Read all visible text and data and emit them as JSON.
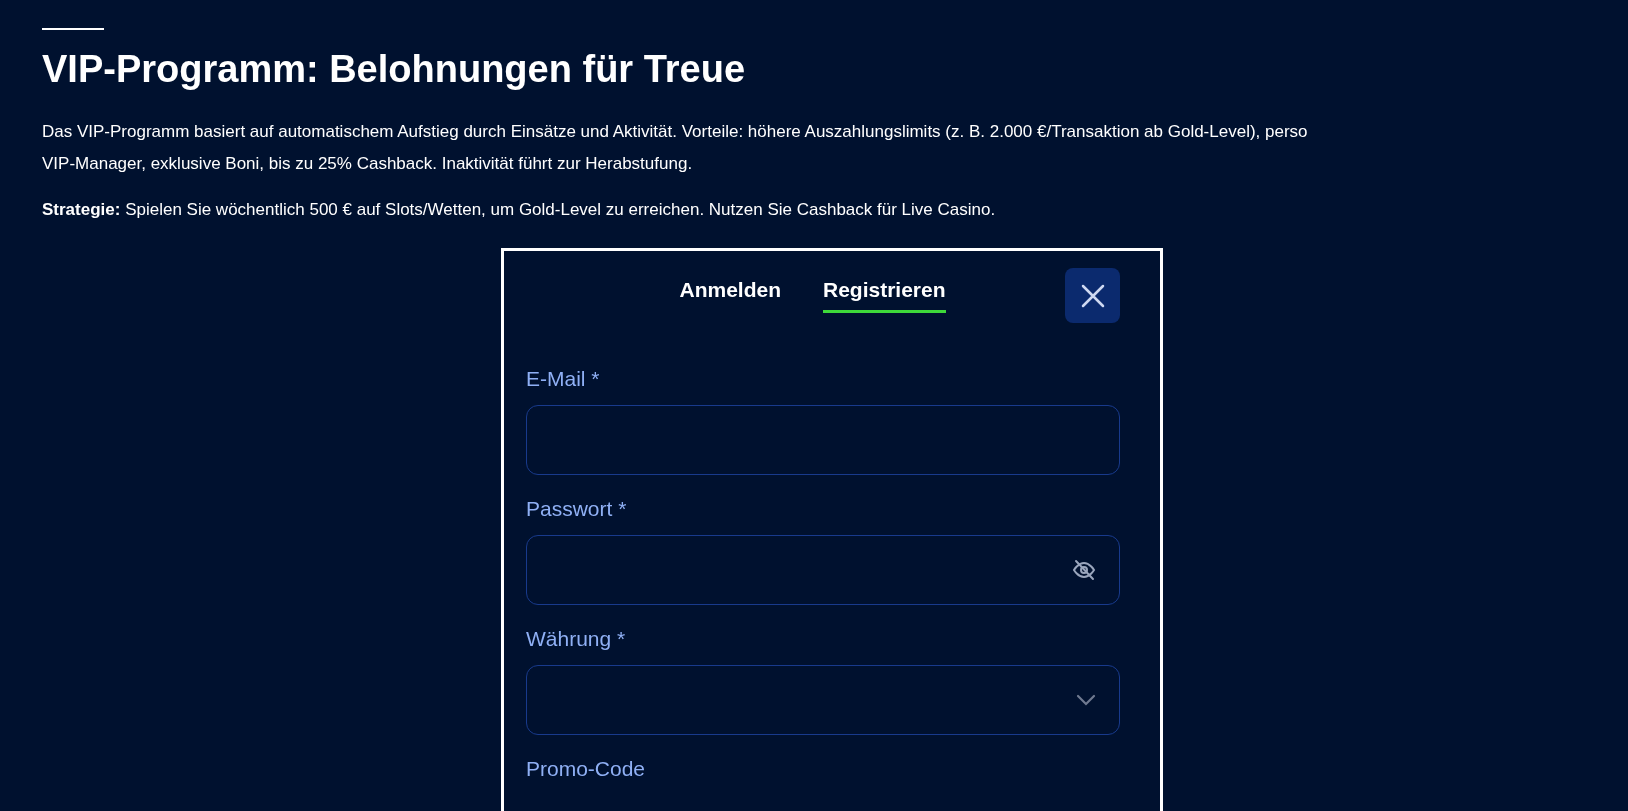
{
  "article": {
    "title": "VIP-Programm: Belohnungen für Treue",
    "paragraph_lines": [
      "Das VIP-Programm basiert auf automatischem Aufstieg durch Einsätze und Aktivität. Vorteile: höhere Auszahlungslimits (z. B. 2.000 €/Transaktion ab Gold-Level), perso",
      "VIP-Manager, exklusive Boni, bis zu 25% Cashback. Inaktivität führt zur Herabstufung."
    ],
    "strategy": "**Strategie:** Spielen Sie wöchentlich 500 € auf Slots/Wetten, um Gold-Level zu erreichen. Nutzen Sie Cashback für Live Casino."
  },
  "dialog": {
    "tabs": [
      {
        "label": "Anmelden",
        "selected": false
      },
      {
        "label": "Registrieren",
        "selected": true
      }
    ],
    "fields": [
      {
        "kind": "text",
        "label": "E-Mail *"
      },
      {
        "kind": "password",
        "label": "Passwort *"
      },
      {
        "kind": "select",
        "label": "Währung *"
      },
      {
        "kind": "label_only",
        "label": "Promo-Code"
      }
    ]
  }
}
